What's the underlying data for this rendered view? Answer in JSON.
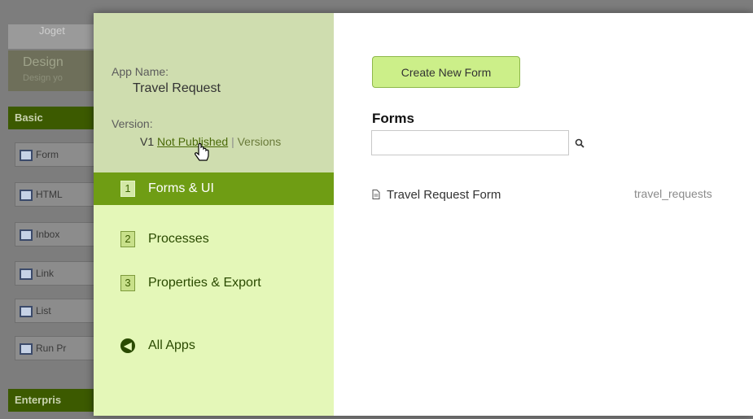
{
  "background": {
    "logo_text": "Joget",
    "design_title": "Design",
    "design_subtitle": "Design yo",
    "section_basic": "Basic",
    "section_enterprise": "Enterpris",
    "palette_items": [
      {
        "label": "Form",
        "icon": "form-icon"
      },
      {
        "label": "HTML",
        "icon": "html-icon"
      },
      {
        "label": "Inbox",
        "icon": "inbox-icon"
      },
      {
        "label": "Link",
        "icon": "link-icon"
      },
      {
        "label": "List",
        "icon": "list-icon"
      },
      {
        "label": "Run Pr",
        "icon": "run-process-icon"
      }
    ]
  },
  "sidebar": {
    "app_name_label": "App Name:",
    "app_name": "Travel Request",
    "version_label": "Version:",
    "version_number": "V1",
    "status_link": "Not Published",
    "separator": "|",
    "versions_link": "Versions",
    "nav": [
      {
        "number": "1",
        "label": "Forms & UI",
        "active": true
      },
      {
        "number": "2",
        "label": "Processes",
        "active": false
      },
      {
        "number": "3",
        "label": "Properties & Export",
        "active": false
      }
    ],
    "all_apps": "All Apps"
  },
  "main": {
    "create_button": "Create New Form",
    "forms_heading": "Forms",
    "search_value": "",
    "forms": [
      {
        "name": "Travel Request Form",
        "table": "travel_requests"
      }
    ]
  },
  "colors": {
    "accent": "#6f9d14",
    "sidebar_bg": "#e4f7b8",
    "button_bg": "#ccef89"
  }
}
